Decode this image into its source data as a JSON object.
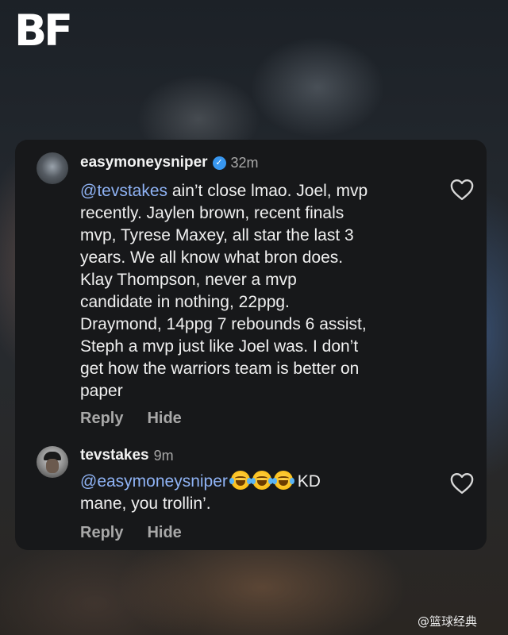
{
  "logo": {
    "text": "BF"
  },
  "comments": [
    {
      "username": "easymoneysniper",
      "verified": true,
      "time": "32m",
      "mention": "@tevstakes",
      "text_lines": [
        " ain’t close lmao. Joel, mvp",
        "recently. Jaylen brown, recent finals",
        "mvp, Tyrese Maxey, all star the last 3",
        "years. We all know what bron does.",
        "Klay Thompson, never a mvp",
        "candidate in nothing, 22ppg.",
        "Draymond, 14ppg 7 rebounds 6 assist,",
        "Steph a mvp just like Joel was. I don’t",
        "get how the warriors team is better on",
        "paper"
      ],
      "reply_label": "Reply",
      "hide_label": "Hide",
      "like_icon": "heart-outline-icon"
    },
    {
      "username": "tevstakes",
      "verified": false,
      "time": "9m",
      "mention": "@easymoneysniper",
      "emoji": "😂😂😂",
      "text_after_emoji": " KD",
      "text_line2": "mane, you trollin’.",
      "reply_label": "Reply",
      "hide_label": "Hide",
      "like_icon": "heart-outline-icon"
    }
  ],
  "watermark": "@篮球经典",
  "colors": {
    "card_bg": "#17181a",
    "mention": "#8fb3f5",
    "verified": "#3897f0",
    "muted": "#a8a8a8"
  }
}
